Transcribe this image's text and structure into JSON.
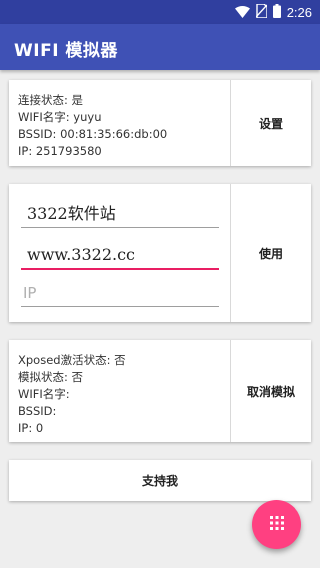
{
  "status_bar": {
    "time": "2:26"
  },
  "app_bar": {
    "title": "WIFI 模拟器"
  },
  "status_card": {
    "lines": [
      "连接状态: 是",
      "WIFI名字: yuyu",
      "BSSID: 00:81:35:66:db:00",
      "IP: 251793580"
    ],
    "button_label": "设置"
  },
  "input_card": {
    "ssid_value": "3322软件站",
    "bssid_value": "www.3322.cc",
    "ip_placeholder": "IP",
    "button_label": "使用"
  },
  "xposed_card": {
    "lines": [
      "Xposed激活状态: 否",
      "模拟状态: 否",
      "WIFI名字:",
      "BSSID:",
      "IP: 0"
    ],
    "button_label": "取消模拟"
  },
  "support_button": {
    "label": "支持我"
  },
  "colors": {
    "primary": "#3f51b5",
    "primary_dark": "#303f9f",
    "accent": "#ff4081",
    "input_underline_active": "#e91e63"
  },
  "fab": {
    "icon": "grid-icon"
  }
}
